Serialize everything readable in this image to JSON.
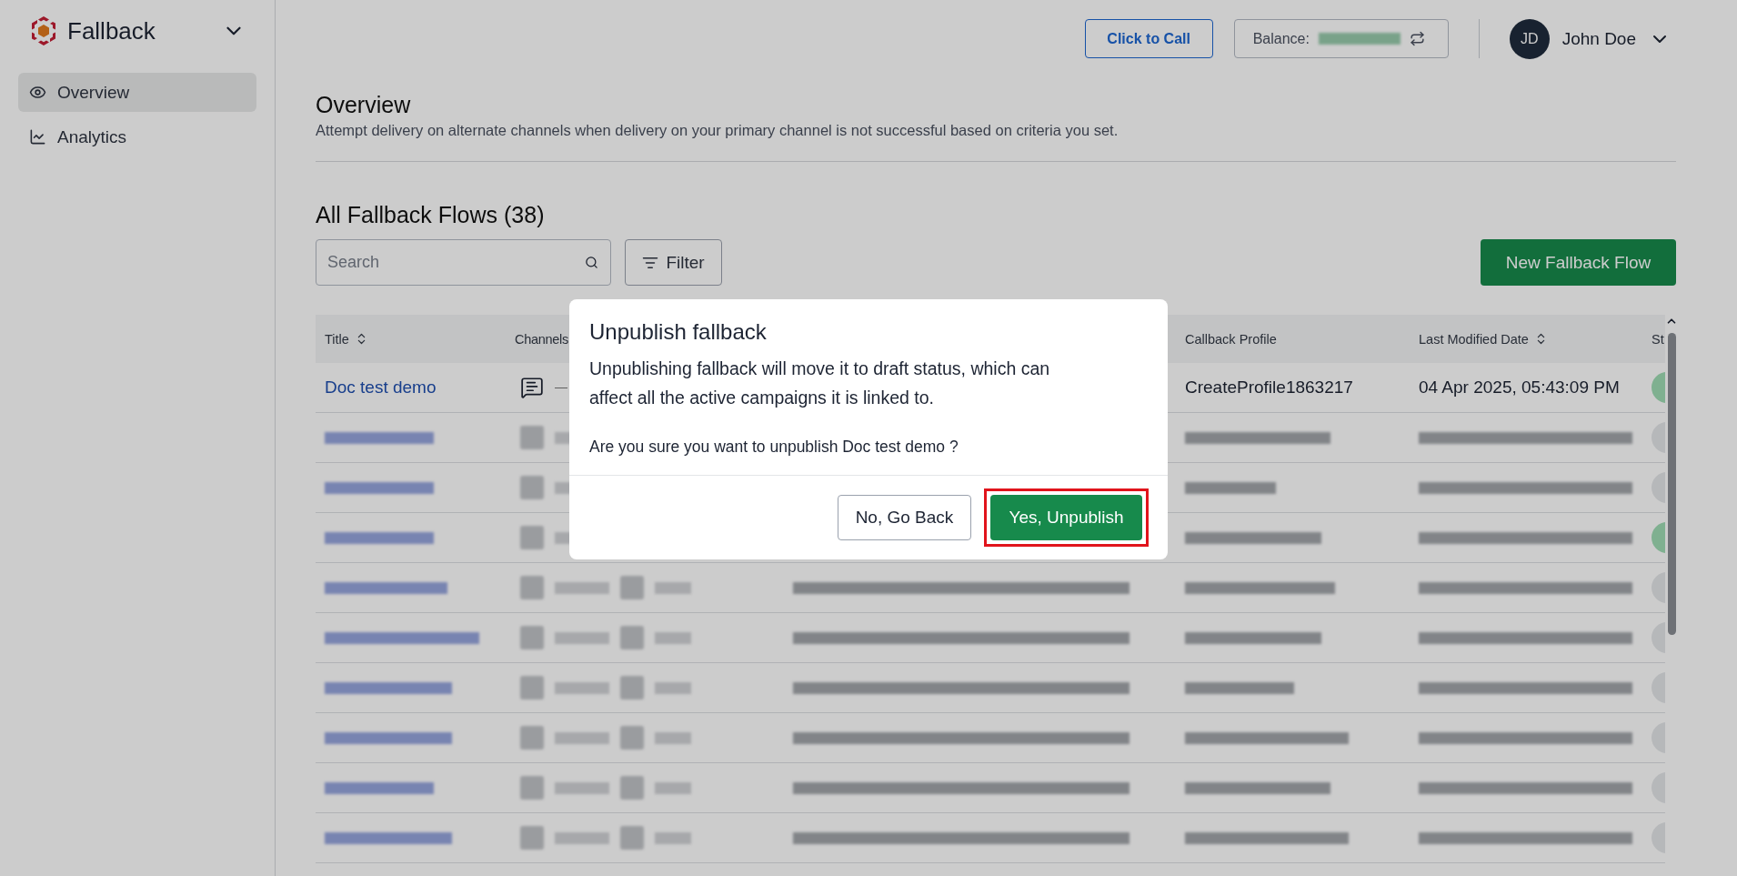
{
  "sidebar": {
    "app_name": "Fallback",
    "items": [
      {
        "label": "Overview",
        "kind": "eye",
        "selected": true
      },
      {
        "label": "Analytics",
        "kind": "chart",
        "selected": false
      }
    ]
  },
  "header": {
    "call_button": "Click to Call",
    "balance_label": "Balance:",
    "user": {
      "initials": "JD",
      "name": "John Doe"
    }
  },
  "page": {
    "title": "Overview",
    "description": "Attempt delivery on alternate channels when delivery on your primary channel is not successful based on criteria you set."
  },
  "flows": {
    "heading": "All Fallback Flows (38)",
    "search": {
      "placeholder": "Search"
    },
    "filter_button": "Filter",
    "new_button": "New Fallback Flow",
    "columns": [
      {
        "label": "Title",
        "sortable": true
      },
      {
        "label": "Channels"
      },
      {
        "label": "Callback Profile",
        "sortable": false
      },
      {
        "label": "Last Modified Date",
        "sortable": true
      },
      {
        "label": "St"
      }
    ],
    "rows": [
      {
        "kind": "visible",
        "title": "Doc test demo",
        "callback_profile": "CreateProfile1863217",
        "modified": "04 Apr 2025, 05:43:09 PM",
        "on": true
      },
      {
        "kind": "redacted",
        "on": false
      },
      {
        "kind": "redacted",
        "on": false
      },
      {
        "kind": "redacted",
        "on": true
      },
      {
        "kind": "redacted",
        "on": false
      },
      {
        "kind": "redacted",
        "on": false
      },
      {
        "kind": "redacted",
        "on": false
      },
      {
        "kind": "redacted",
        "on": false
      },
      {
        "kind": "redacted",
        "on": false
      },
      {
        "kind": "redacted",
        "on": false
      }
    ]
  },
  "dialog": {
    "title": "Unpublish fallback",
    "message": "Unpublishing fallback will move it to draft status, which can affect all the active campaigns it is linked to.",
    "question": "Are you sure you want to unpublish Doc test demo ?",
    "cancel_button": "No, Go Back",
    "confirm_button": "Yes, Unpublish",
    "confirm_highlighted": true
  }
}
